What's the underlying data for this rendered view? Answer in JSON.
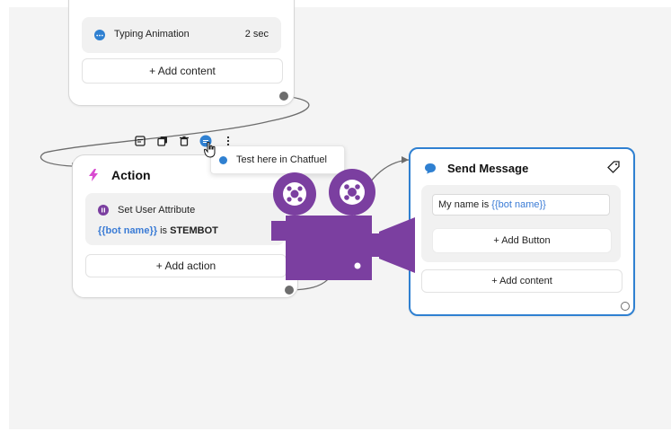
{
  "typing_card": {
    "typing_label": "Typing Animation",
    "typing_duration": "2 sec",
    "add_content_label": "+ Add content"
  },
  "action_card": {
    "title": "Action",
    "set_attribute_label": "Set User Attribute",
    "attribute_var": "{{bot name}}",
    "attribute_is": "is",
    "attribute_value": "STEMBOT",
    "add_action_label": "+ Add action"
  },
  "toolbar": {
    "icons": [
      "note-icon",
      "duplicate-icon",
      "trash-icon",
      "chatfuel-test-icon",
      "more-icon"
    ]
  },
  "tooltip": {
    "label": "Test here in Chatfuel"
  },
  "send_message_card": {
    "title": "Send Message",
    "text_prefix": "My name is ",
    "text_var": "{{bot name}}",
    "add_button_label": "+ Add Button",
    "add_content_label": "+ Add content"
  },
  "colors": {
    "accent_blue": "#2f80d1",
    "purple": "#7b3fa0",
    "action_pink": "#d84bd0",
    "canvas_bg": "#f4f4f4"
  }
}
